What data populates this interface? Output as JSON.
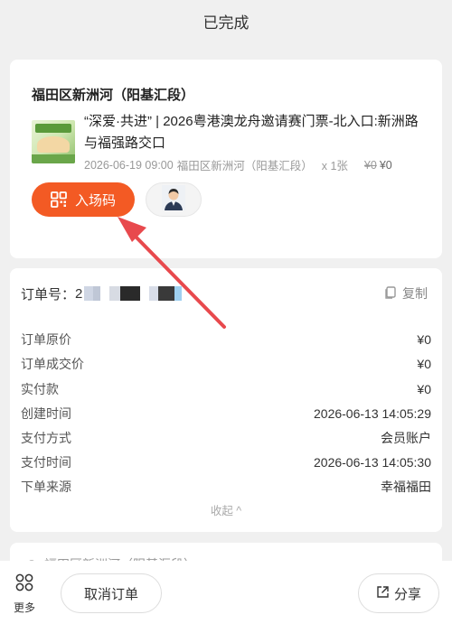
{
  "header": {
    "title": "已完成"
  },
  "ticket": {
    "venue": "福田区新洲河（阳基汇段）",
    "name": "“深爱·共进” | 2026粤港澳龙舟邀请赛门票-北入口:新洲路与福强路交口",
    "datetime": "2026-06-19 09:00",
    "location": "福田区新洲河（阳基汇段）",
    "quantity": "x 1张",
    "original_price": "¥0",
    "price": "¥0",
    "entry_button": "入场码",
    "icons": {
      "entry": "qr-code-icon",
      "avatar": "person-avatar-icon"
    }
  },
  "order": {
    "number_label": "订单号：",
    "number_visible": "2",
    "copy_label": "复制",
    "rows": [
      {
        "label": "订单原价",
        "value": "¥0"
      },
      {
        "label": "订单成交价",
        "value": "¥0"
      },
      {
        "label": "实付款",
        "value": "¥0"
      },
      {
        "label": "创建时间",
        "value": "2026-06-13 14:05:29"
      },
      {
        "label": "支付方式",
        "value": "会员账户"
      },
      {
        "label": "支付时间",
        "value": "2026-06-13 14:05:30"
      },
      {
        "label": "下单来源",
        "value": "幸福福田"
      }
    ],
    "collapse_label": "收起 ^"
  },
  "next_card": {
    "text": "福田区新洲河（阳基汇段）"
  },
  "bottom": {
    "more_label": "更多",
    "cancel_label": "取消订单",
    "share_label": "分享"
  },
  "colors": {
    "accent": "#f35a24",
    "arrow": "#e8494d"
  }
}
